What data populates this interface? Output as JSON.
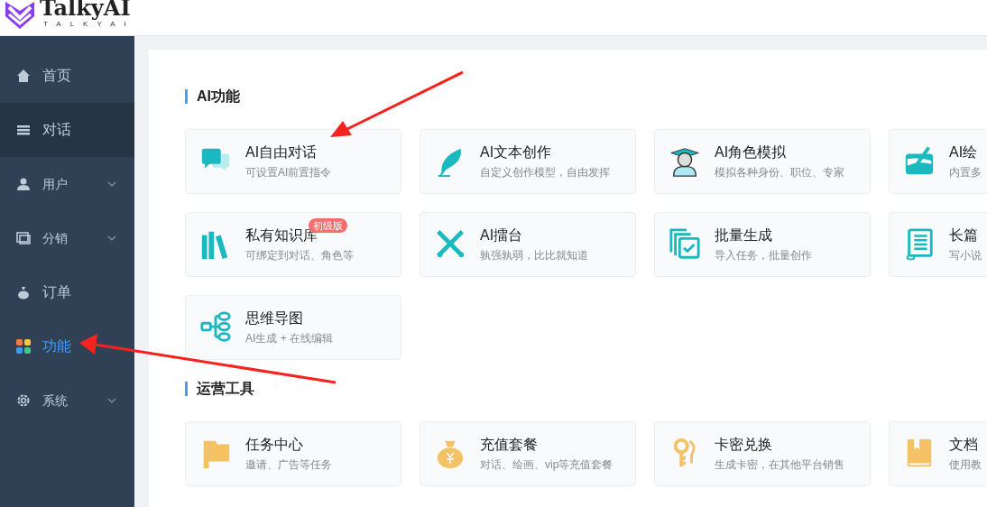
{
  "logo": {
    "name": "TalkyAI",
    "tagline": "TALKYAI"
  },
  "sidebar": {
    "items": [
      {
        "label": "首页",
        "selected": false,
        "hovered": false,
        "expandable": false
      },
      {
        "label": "对话",
        "selected": false,
        "hovered": true,
        "expandable": false
      },
      {
        "label": "用户",
        "selected": false,
        "hovered": false,
        "expandable": true
      },
      {
        "label": "分销",
        "selected": false,
        "hovered": false,
        "expandable": true
      },
      {
        "label": "订单",
        "selected": false,
        "hovered": false,
        "expandable": false
      },
      {
        "label": "功能",
        "selected": true,
        "hovered": false,
        "expandable": false
      },
      {
        "label": "系统",
        "selected": false,
        "hovered": false,
        "expandable": true
      }
    ]
  },
  "sections": [
    {
      "title": "AI功能",
      "cards": [
        {
          "title": "AI自由对话",
          "subtitle": "可设置AI前置指令"
        },
        {
          "title": "AI文本创作",
          "subtitle": "自定义创作模型，自由发挥"
        },
        {
          "title": "AI角色模拟",
          "subtitle": "模拟各种身份、职位、专家"
        },
        {
          "title": "AI绘",
          "subtitle": "内置多"
        },
        {
          "title": "私有知识库",
          "subtitle": "可绑定到对话、角色等",
          "badge": "初级版"
        },
        {
          "title": "AI擂台",
          "subtitle": "孰强孰弱，比比就知道"
        },
        {
          "title": "批量生成",
          "subtitle": "导入任务，批量创作"
        },
        {
          "title": "长篇",
          "subtitle": "写小说"
        },
        {
          "title": "思维导图",
          "subtitle": "AI生成 + 在线编辑"
        }
      ]
    },
    {
      "title": "运营工具",
      "cards": [
        {
          "title": "任务中心",
          "subtitle": "邀请、广告等任务"
        },
        {
          "title": "充值套餐",
          "subtitle": "对话、绘画、vip等充值套餐"
        },
        {
          "title": "卡密兑换",
          "subtitle": "生成卡密，在其他平台销售"
        },
        {
          "title": "文档",
          "subtitle": "使用教"
        }
      ]
    }
  ]
}
